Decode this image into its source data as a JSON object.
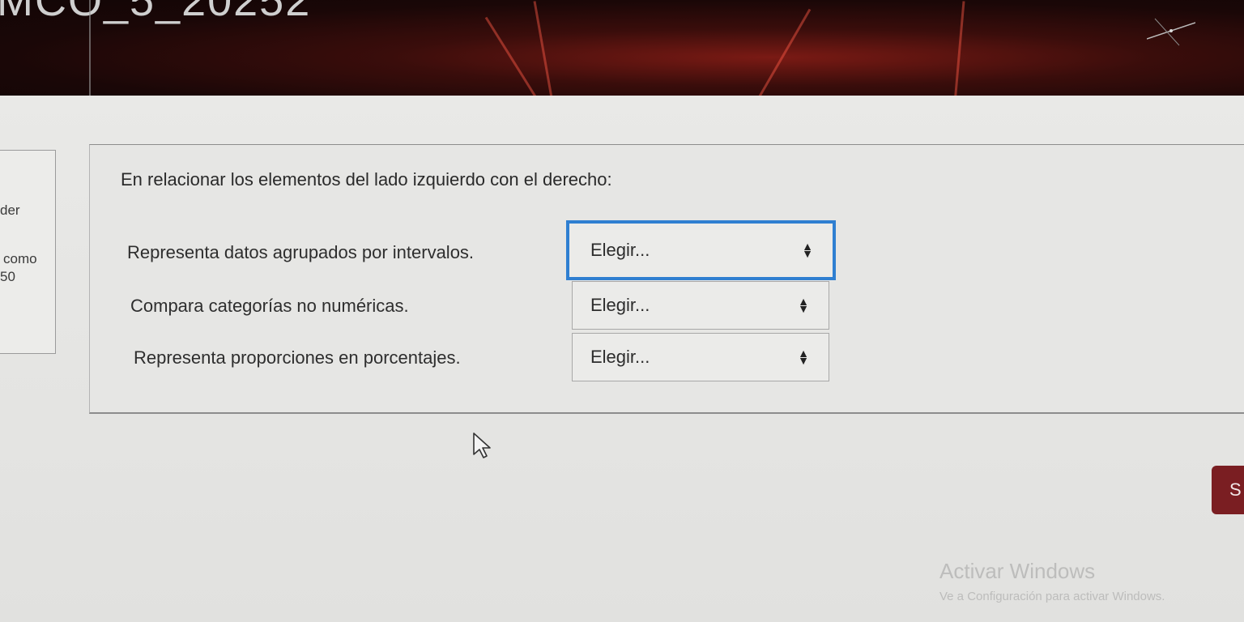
{
  "banner": {
    "title": "MCO_5_20252"
  },
  "info_card": {
    "line1": "der",
    "line2": "como",
    "line3": "50"
  },
  "question": {
    "prompt": "En relacionar los elementos del lado izquierdo con el derecho:",
    "rows": [
      {
        "stem": "Representa datos agrupados por intervalos.",
        "selected": "Elegir...",
        "focused": true
      },
      {
        "stem": "Compara categorías no numéricas.",
        "selected": "Elegir...",
        "focused": false
      },
      {
        "stem": "Representa proporciones en porcentajes.",
        "selected": "Elegir...",
        "focused": false
      }
    ],
    "select_icon": "up-down-arrows-icon"
  },
  "nav": {
    "next_label": "S"
  },
  "watermark": {
    "title": "Activar Windows",
    "subtitle": "Ve a Configuración para activar Windows."
  },
  "colors": {
    "banner_red": "#7a1a14",
    "focus_blue": "#2f7fd1",
    "button_maroon": "#7a1e22"
  }
}
